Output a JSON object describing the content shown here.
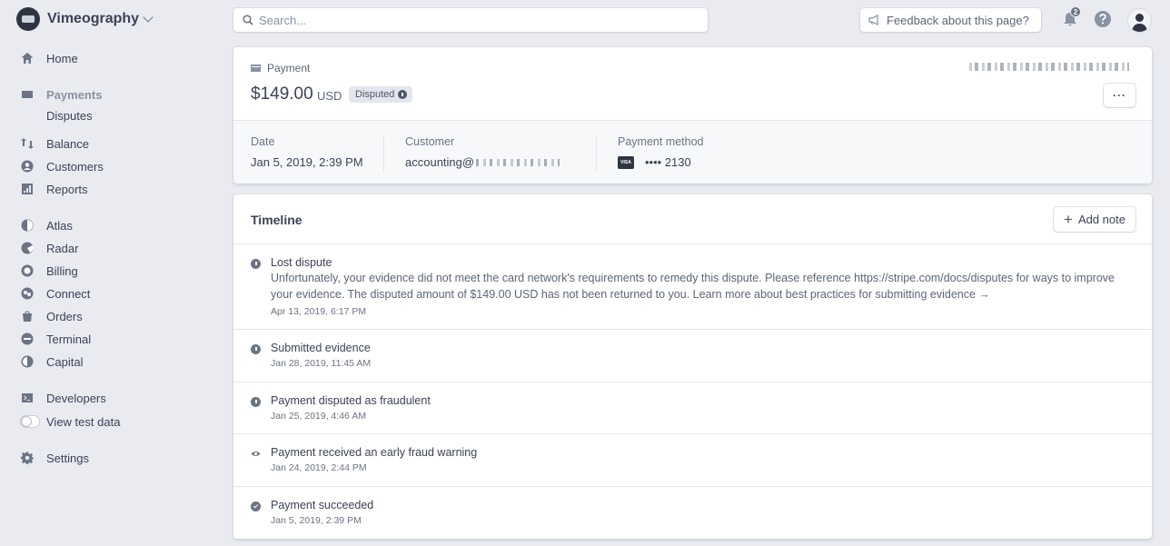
{
  "brand": {
    "name": "Vimeography"
  },
  "sidebar": {
    "items": [
      {
        "label": "Home",
        "icon": "home-icon"
      },
      {
        "label": "Payments",
        "icon": "payments-icon"
      },
      {
        "label": "Disputes"
      },
      {
        "label": "Balance",
        "icon": "balance-icon"
      },
      {
        "label": "Customers",
        "icon": "customers-icon"
      },
      {
        "label": "Reports",
        "icon": "reports-icon"
      },
      {
        "label": "Atlas",
        "icon": "atlas-icon"
      },
      {
        "label": "Radar",
        "icon": "radar-icon"
      },
      {
        "label": "Billing",
        "icon": "billing-icon"
      },
      {
        "label": "Connect",
        "icon": "connect-icon"
      },
      {
        "label": "Orders",
        "icon": "orders-icon"
      },
      {
        "label": "Terminal",
        "icon": "terminal-icon"
      },
      {
        "label": "Capital",
        "icon": "capital-icon"
      },
      {
        "label": "Developers",
        "icon": "developers-icon"
      },
      {
        "label": "View test data",
        "icon": "toggle"
      },
      {
        "label": "Settings",
        "icon": "gear-icon"
      }
    ]
  },
  "topbar": {
    "search_placeholder": "Search...",
    "feedback_label": "Feedback about this page?",
    "notification_count": "2"
  },
  "payment": {
    "section_label": "Payment",
    "amount": "$149.00",
    "currency": "USD",
    "status": "Disputed",
    "more_label": "···",
    "details": {
      "date_label": "Date",
      "date_value": "Jan 5, 2019, 2:39 PM",
      "customer_label": "Customer",
      "customer_value": "accounting@",
      "method_label": "Payment method",
      "method_value": "•••• 2130",
      "card_brand": "VISA"
    }
  },
  "timeline": {
    "title": "Timeline",
    "add_note_label": "Add note",
    "events": [
      {
        "title": "Lost dispute",
        "body": "Unfortunately, your evidence did not meet the card network's requirements to remedy this dispute. Please reference https://stripe.com/docs/disputes for ways to improve your evidence. The disputed amount of $149.00 USD has not been returned to you. Learn more about best practices for submitting evidence →",
        "time": "Apr 13, 2019, 6:17 PM",
        "icon": "info-icon"
      },
      {
        "title": "Submitted evidence",
        "time": "Jan 28, 2019, 11:45 AM",
        "icon": "info-icon"
      },
      {
        "title": "Payment disputed as fraudulent",
        "time": "Jan 25, 2019, 4:46 AM",
        "icon": "info-icon"
      },
      {
        "title": "Payment received an early fraud warning",
        "time": "Jan 24, 2019, 2:44 PM",
        "icon": "eye-icon"
      },
      {
        "title": "Payment succeeded",
        "time": "Jan 5, 2019, 2:39 PM",
        "icon": "check-circle-icon"
      }
    ]
  },
  "colors": {
    "background": "#e9ebf1",
    "text": "#3c4257",
    "muted": "#6b7385",
    "pill": "#e3e6ec"
  }
}
